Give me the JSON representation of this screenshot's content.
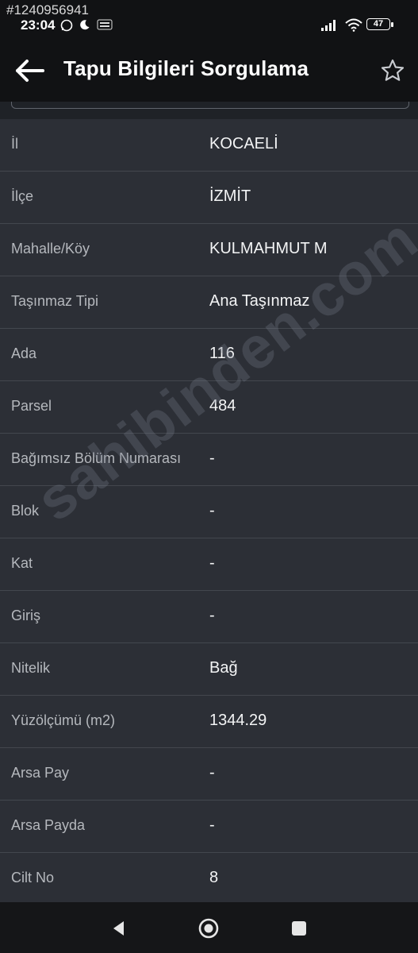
{
  "status": {
    "id_overlay": "#1240956941",
    "time": "23:04",
    "battery": "47"
  },
  "appbar": {
    "title": "Tapu Bilgileri Sorgulama",
    "back_icon": "arrow-left-icon",
    "favorite_icon": "star-outline-icon"
  },
  "rows": [
    {
      "label": "İl",
      "value": "KOCAELİ"
    },
    {
      "label": "İlçe",
      "value": "İZMİT"
    },
    {
      "label": "Mahalle/Köy",
      "value": "KULMAHMUT M"
    },
    {
      "label": "Taşınmaz Tipi",
      "value": "Ana Taşınmaz"
    },
    {
      "label": "Ada",
      "value": "116"
    },
    {
      "label": "Parsel",
      "value": "484"
    },
    {
      "label": "Bağımsız Bölüm Numarası",
      "value": "-"
    },
    {
      "label": "Blok",
      "value": "-"
    },
    {
      "label": "Kat",
      "value": "-"
    },
    {
      "label": "Giriş",
      "value": "-"
    },
    {
      "label": "Nitelik",
      "value": "Bağ"
    },
    {
      "label": "Yüzölçümü (m2)",
      "value": "1344.29"
    },
    {
      "label": "Arsa Pay",
      "value": "-"
    },
    {
      "label": "Arsa Payda",
      "value": "-"
    },
    {
      "label": "Cilt No",
      "value": "8"
    }
  ],
  "watermark": "sahibinden.com",
  "colors": {
    "background": "#2c2f36",
    "appbar": "#111214",
    "divider": "#43474e"
  }
}
